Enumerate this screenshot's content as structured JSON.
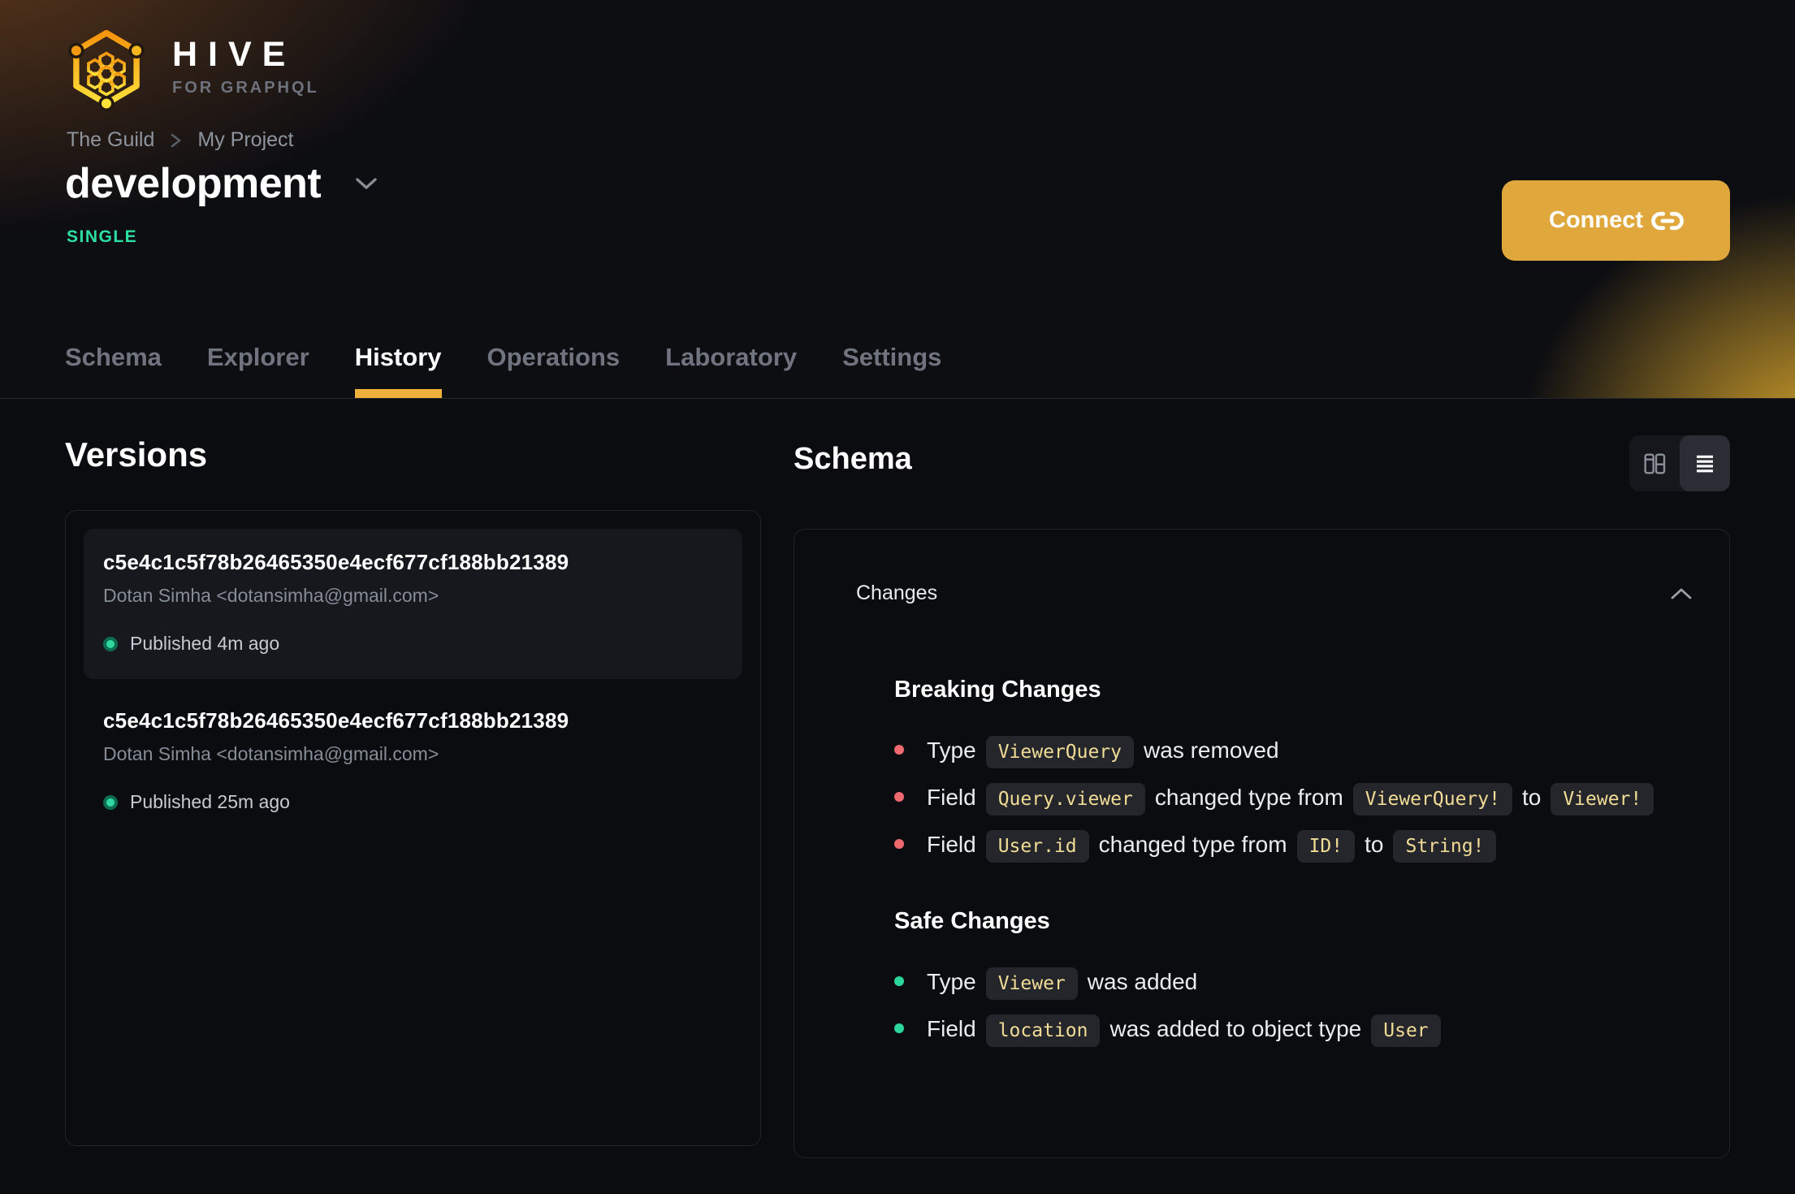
{
  "brand": {
    "name": "HIVE",
    "tagline": "FOR GRAPHQL"
  },
  "header": {
    "breadcrumb": {
      "items": [
        "The Guild",
        "My Project"
      ]
    },
    "title": "development",
    "badge": "SINGLE",
    "connect_label": "Connect"
  },
  "tabs": [
    {
      "label": "Schema",
      "active": false
    },
    {
      "label": "Explorer",
      "active": false
    },
    {
      "label": "History",
      "active": true
    },
    {
      "label": "Operations",
      "active": false
    },
    {
      "label": "Laboratory",
      "active": false
    },
    {
      "label": "Settings",
      "active": false
    }
  ],
  "versions": {
    "title": "Versions",
    "items": [
      {
        "hash": "c5e4c1c5f78b26465350e4ecf677cf188bb21389",
        "author": "Dotan Simha <dotansimha@gmail.com>",
        "status": "Published 4m ago",
        "selected": true
      },
      {
        "hash": "c5e4c1c5f78b26465350e4ecf677cf188bb21389",
        "author": "Dotan Simha <dotansimha@gmail.com>",
        "status": "Published 25m ago",
        "selected": false
      }
    ]
  },
  "schema_panel": {
    "title": "Schema",
    "view_toggle": [
      {
        "icon": "columns-icon",
        "active": false
      },
      {
        "icon": "list-icon",
        "active": true
      }
    ],
    "changes": {
      "title": "Changes",
      "collapsed": false,
      "sections": [
        {
          "heading": "Breaking Changes",
          "severity": "breaking",
          "items": [
            [
              {
                "t": "text",
                "v": "Type"
              },
              {
                "t": "code",
                "v": "ViewerQuery"
              },
              {
                "t": "text",
                "v": "was removed"
              }
            ],
            [
              {
                "t": "text",
                "v": "Field"
              },
              {
                "t": "code",
                "v": "Query.viewer"
              },
              {
                "t": "text",
                "v": "changed type from"
              },
              {
                "t": "code",
                "v": "ViewerQuery!"
              },
              {
                "t": "text",
                "v": "to"
              },
              {
                "t": "code",
                "v": "Viewer!"
              }
            ],
            [
              {
                "t": "text",
                "v": "Field"
              },
              {
                "t": "code",
                "v": "User.id"
              },
              {
                "t": "text",
                "v": "changed type from"
              },
              {
                "t": "code",
                "v": "ID!"
              },
              {
                "t": "text",
                "v": "to"
              },
              {
                "t": "code",
                "v": "String!"
              }
            ]
          ]
        },
        {
          "heading": "Safe Changes",
          "severity": "safe",
          "items": [
            [
              {
                "t": "text",
                "v": "Type"
              },
              {
                "t": "code",
                "v": "Viewer"
              },
              {
                "t": "text",
                "v": "was added"
              }
            ],
            [
              {
                "t": "text",
                "v": "Field"
              },
              {
                "t": "code",
                "v": "location"
              },
              {
                "t": "text",
                "v": "was added to object type"
              },
              {
                "t": "code",
                "v": "User"
              }
            ]
          ]
        }
      ]
    }
  },
  "colors": {
    "accent": "#eeb13c",
    "connect_button": "#dfa73c",
    "badge_green": "#2de0a1",
    "published_dot": "#2fd9a0",
    "breaking_bullet": "#ef6a70",
    "safe_bullet": "#2dd79b",
    "code_text": "#f1dc96",
    "code_bg": "#24262c"
  }
}
